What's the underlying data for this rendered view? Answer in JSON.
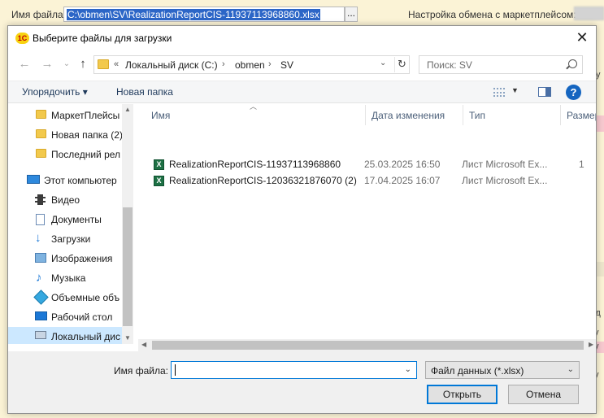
{
  "background": {
    "file_label": "Имя файла:",
    "file_path": "C:\\obmen\\SV\\RealizationReportCIS-11937113968860.xlsx",
    "dots_button": "...",
    "marketplace_label": "Настройка обмена с маркетплейсом:",
    "right_col_labels": [
      "Су",
      "Ед",
      "ру",
      "ру",
      "ру"
    ]
  },
  "dialog": {
    "title": "Выберите файлы для загрузки",
    "logo_text": "1С",
    "close_symbol": "✕",
    "nav": {
      "back": "←",
      "forward": "→",
      "recent": "⌄",
      "up": "↑"
    },
    "address": {
      "prefix": "«",
      "crumbs": [
        "Локальный диск (C:)",
        "obmen",
        "SV"
      ],
      "separator": "›",
      "dropdown": "⌄",
      "refresh": "↻"
    },
    "search": {
      "placeholder": "Поиск: SV"
    },
    "toolbar": {
      "organize": "Упорядочить ▾",
      "new_folder": "Новая папка",
      "view_caret": "▼",
      "help": "?"
    },
    "nav_pane": {
      "items": [
        {
          "label": "МаркетПлейсы",
          "icon": "folder-icon"
        },
        {
          "label": "Новая папка (2)",
          "icon": "folder-icon"
        },
        {
          "label": "Последний рел",
          "icon": "folder-icon"
        },
        {
          "label": "Этот компьютер",
          "icon": "computer-icon"
        },
        {
          "label": "Видео",
          "icon": "video-icon"
        },
        {
          "label": "Документы",
          "icon": "documents-icon"
        },
        {
          "label": "Загрузки",
          "icon": "download-icon"
        },
        {
          "label": "Изображения",
          "icon": "images-icon"
        },
        {
          "label": "Музыка",
          "icon": "music-icon"
        },
        {
          "label": "Объемные объ",
          "icon": "3d-objects-icon"
        },
        {
          "label": "Рабочий стол",
          "icon": "desktop-icon"
        },
        {
          "label": "Локальный дис",
          "icon": "local-disk-icon"
        }
      ]
    },
    "file_list": {
      "columns": [
        "Имя",
        "Дата изменения",
        "Тип",
        "Размер"
      ],
      "rows": [
        {
          "name": "RealizationReportCIS-11937113968860",
          "date": "25.03.2025 16:50",
          "type": "Лист Microsoft Ex...",
          "size": "1"
        },
        {
          "name": "RealizationReportCIS-12036321876070 (2)",
          "date": "17.04.2025 16:07",
          "type": "Лист Microsoft Ex...",
          "size": ""
        }
      ]
    },
    "bottom": {
      "filename_label": "Имя файла:",
      "filename_value": "",
      "filter": "Файл данных (*.xlsx)",
      "open_button": "Открыть",
      "cancel_button": "Отмена"
    },
    "colors": {
      "selection": "#cce8ff",
      "accent": "#0078d7",
      "excel": "#1d7044"
    }
  }
}
